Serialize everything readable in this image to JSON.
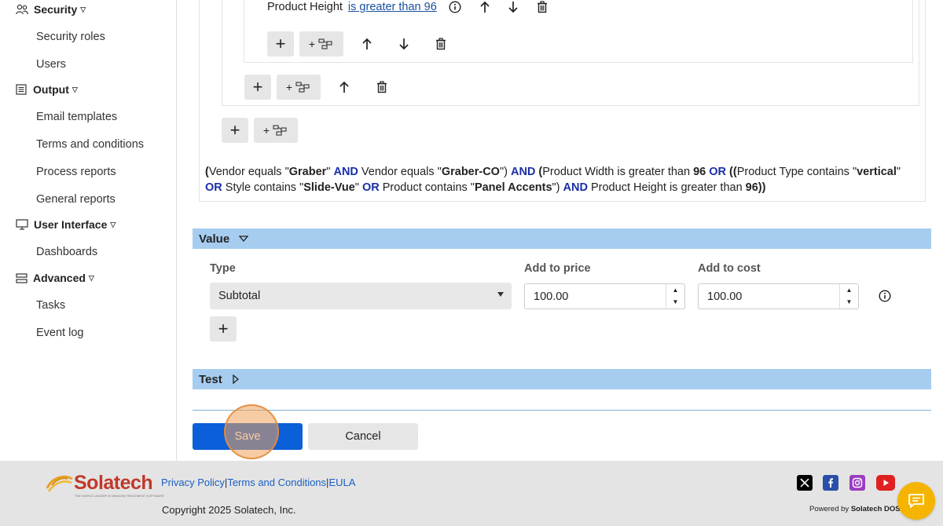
{
  "sidebar": {
    "groups": [
      {
        "label": "Security",
        "icon": "users-icon"
      },
      {
        "label": "Output",
        "icon": "output-icon"
      },
      {
        "label": "User Interface",
        "icon": "monitor-icon"
      },
      {
        "label": "Advanced",
        "icon": "advanced-icon"
      }
    ],
    "items": {
      "security_roles": "Security roles",
      "users": "Users",
      "email_templates": "Email templates",
      "terms": "Terms and conditions",
      "process_reports": "Process reports",
      "general_reports": "General reports",
      "dashboards": "Dashboards",
      "tasks": "Tasks",
      "event_log": "Event log"
    }
  },
  "condition": {
    "rule": {
      "field": "Product Height",
      "operator_value": "is greater than 96"
    },
    "expression": [
      {
        "t": "(",
        "s": "b"
      },
      {
        "t": "Vendor equals \"",
        "s": "n"
      },
      {
        "t": "Graber",
        "s": "b"
      },
      {
        "t": "\" ",
        "s": "n"
      },
      {
        "t": "AND",
        "s": "kw"
      },
      {
        "t": " Vendor equals \"",
        "s": "n"
      },
      {
        "t": "Graber-CO",
        "s": "b"
      },
      {
        "t": "\") ",
        "s": "n"
      },
      {
        "t": "AND",
        "s": "kw"
      },
      {
        "t": " (",
        "s": "b"
      },
      {
        "t": "Product Width is greater than ",
        "s": "n"
      },
      {
        "t": "96",
        "s": "b"
      },
      {
        "t": " ",
        "s": "n"
      },
      {
        "t": "OR",
        "s": "kw"
      },
      {
        "t": " ((",
        "s": "b"
      },
      {
        "t": "Product Type contains \"",
        "s": "n"
      },
      {
        "t": "vertical",
        "s": "b"
      },
      {
        "t": "\" ",
        "s": "n"
      },
      {
        "t": "OR",
        "s": "kw"
      },
      {
        "t": " Style contains \"",
        "s": "n"
      },
      {
        "t": "Slide-Vue",
        "s": "b"
      },
      {
        "t": "\" ",
        "s": "n"
      },
      {
        "t": "OR",
        "s": "kw"
      },
      {
        "t": " Product contains \"",
        "s": "n"
      },
      {
        "t": "Panel Accents",
        "s": "b"
      },
      {
        "t": "\") ",
        "s": "n"
      },
      {
        "t": "AND",
        "s": "kw"
      },
      {
        "t": " Product Height is greater than ",
        "s": "n"
      },
      {
        "t": "96))",
        "s": "b"
      }
    ]
  },
  "value_section": {
    "title": "Value",
    "columns": {
      "type": "Type",
      "add_price": "Add to price",
      "add_cost": "Add to cost"
    },
    "type_value": "Subtotal",
    "add_price_value": "100.00",
    "add_cost_value": "100.00"
  },
  "test_section": {
    "title": "Test"
  },
  "actions": {
    "save": "Save",
    "cancel": "Cancel"
  },
  "footer": {
    "logo": "Solatech",
    "logo_tagline": "THE WORLD LEADER IN WINDOW TREATMENT SOFTWARE",
    "privacy": "Privacy Policy",
    "terms": "Terms and Conditions",
    "eula": "EULA",
    "copyright": "Copyright 2025 Solatech, Inc.",
    "powered_prefix": "Powered by ",
    "powered_brand": "Solatech DOS"
  },
  "colors": {
    "accent": "#0b5fd8",
    "section_bar": "#a6cdf0",
    "keyword": "#1a2fa6",
    "chat_fab": "#f5b400"
  }
}
